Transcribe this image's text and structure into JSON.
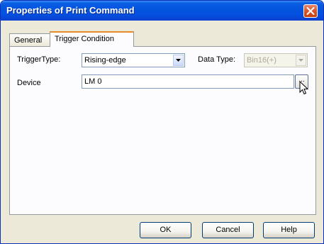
{
  "window": {
    "title": "Properties of Print Command"
  },
  "tabs": [
    {
      "label": "General",
      "selected": false
    },
    {
      "label": "Trigger Condition",
      "selected": true
    }
  ],
  "form": {
    "trigger_type_label": "TriggerType:",
    "trigger_type_value": "Rising-edge",
    "data_type_label": "Data Type:",
    "data_type_value": "Bin16(+)",
    "data_type_enabled": false,
    "device_label": "Device",
    "device_value": "LM 0",
    "browse_label": "..."
  },
  "buttons": {
    "ok": "OK",
    "cancel": "Cancel",
    "help": "Help"
  },
  "colors": {
    "titlebar": "#0455de",
    "close_button": "#d9582e",
    "dialog_bg": "#ece9d8",
    "tab_highlight": "#e68b2c"
  },
  "icons": {
    "close": "close-icon",
    "dropdown": "chevron-down-icon",
    "cursor": "mouse-pointer-icon"
  }
}
